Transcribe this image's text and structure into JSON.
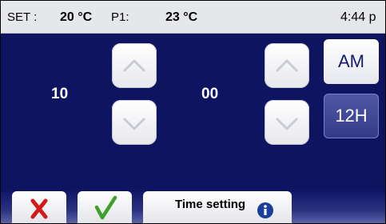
{
  "status_bar": {
    "set_label": "SET :",
    "set_value": "20 °C",
    "p1_label": "P1:",
    "p1_value": "23 °C",
    "clock": "4:44 p"
  },
  "time_setter": {
    "hour": "10",
    "minute": "00"
  },
  "meridiem_button": "AM",
  "format_button": "12H",
  "footer": {
    "title": "Time setting"
  },
  "icons": {
    "cancel": "red-x-icon",
    "confirm": "green-check-icon",
    "info": "info-icon",
    "up": "chevron-up-icon",
    "down": "chevron-down-icon"
  },
  "colors": {
    "background": "#0e1460",
    "cancel": "#d11a1a",
    "confirm": "#3fa02a",
    "info": "#1a3f9a"
  }
}
